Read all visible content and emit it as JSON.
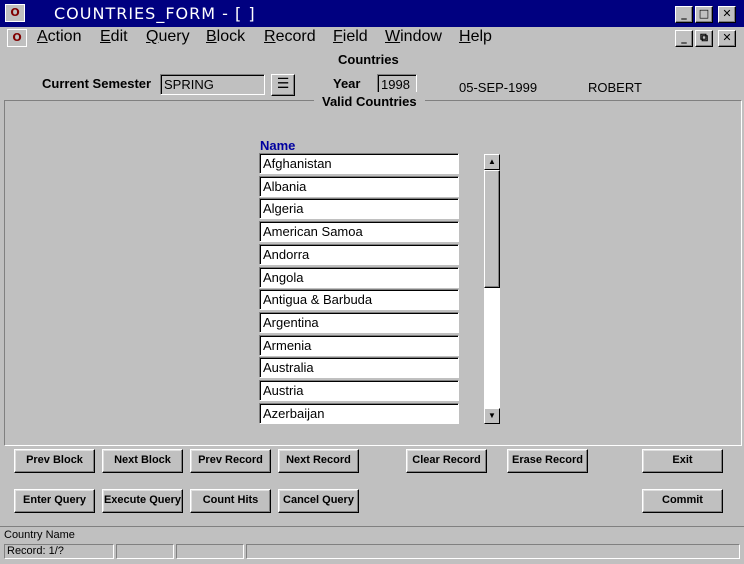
{
  "window": {
    "title": "COUNTRIES_FORM - [ ]",
    "icon": "oracle-forms-icon"
  },
  "menu": {
    "items": [
      {
        "underline": "A",
        "rest": "ction"
      },
      {
        "underline": "E",
        "rest": "dit"
      },
      {
        "underline": "Q",
        "rest": "uery"
      },
      {
        "underline": "B",
        "rest": "lock"
      },
      {
        "underline": "R",
        "rest": "ecord"
      },
      {
        "underline": "F",
        "rest": "ield"
      },
      {
        "underline": "W",
        "rest": "indow"
      },
      {
        "underline": "H",
        "rest": "elp"
      }
    ]
  },
  "header": {
    "form_title": "Countries",
    "semester_label": "Current Semester",
    "semester_value": "SPRING",
    "year_label": "Year",
    "year_value": "1998",
    "date": "05-SEP-1999",
    "user": "ROBERT"
  },
  "block": {
    "title": "Valid Countries",
    "column_header": "Name",
    "rows": [
      "Afghanistan",
      "Albania",
      "Algeria",
      "American Samoa",
      "Andorra",
      "Angola",
      "Antigua & Barbuda",
      "Argentina",
      "Armenia",
      "Australia",
      "Austria",
      "Azerbaijan"
    ],
    "scroll_position": 0
  },
  "buttons": {
    "prev_block": "Prev Block",
    "next_block": "Next Block",
    "prev_record": "Prev Record",
    "next_record": "Next Record",
    "clear_record": "Clear Record",
    "erase_record": "Erase Record",
    "exit": "Exit",
    "enter_query": "Enter Query",
    "execute_query": "Execute Query",
    "count_hits": "Count Hits",
    "cancel_query": "Cancel Query",
    "commit": "Commit"
  },
  "status": {
    "hint": "Country Name",
    "record": "Record: 1/?"
  }
}
